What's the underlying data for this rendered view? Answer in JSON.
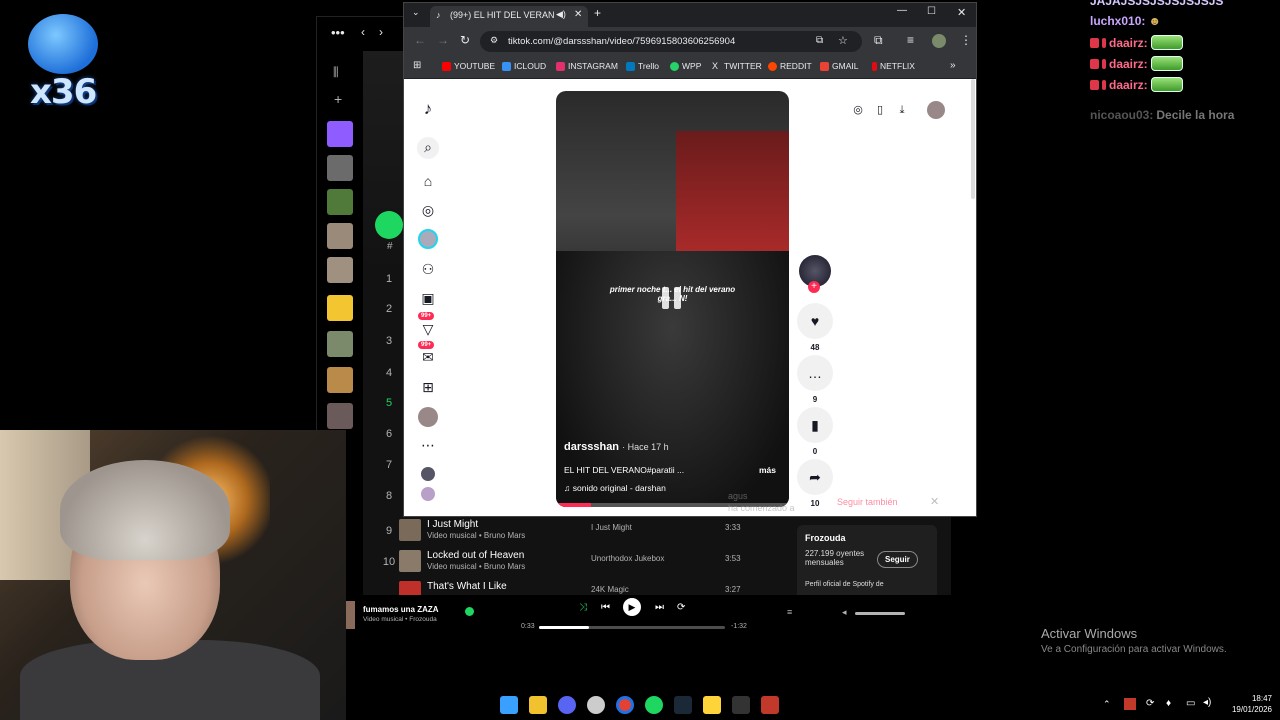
{
  "overlay": {
    "counter_text": "x36"
  },
  "chat": {
    "lines": [
      {
        "user": "JAJAJSJSJSJSJSJSJS",
        "msg": ""
      },
      {
        "user": "luchx010:",
        "msg": ""
      },
      {
        "user": "daairz:",
        "msg": ""
      },
      {
        "user": "daairz:",
        "msg": ""
      },
      {
        "user": "daairz:",
        "msg": ""
      },
      {
        "user": "nicoaou03:",
        "msg": "Decile la hora"
      }
    ]
  },
  "browser": {
    "tab_title": "(99+) EL HIT DEL VERANO",
    "new_tab_label": "+",
    "url": "tiktok.com/@darssshan/video/7596915803606256904",
    "bookmarks": [
      {
        "label": "YOUTUBE",
        "color": "#ff0000"
      },
      {
        "label": "ICLOUD",
        "color": "#3693f3"
      },
      {
        "label": "INSTAGRAM",
        "color": "#e1306c"
      },
      {
        "label": "Trello",
        "color": "#0079bf"
      },
      {
        "label": "WPP",
        "color": "#25d366"
      },
      {
        "label": "TWITTER",
        "color": "#e8eaed"
      },
      {
        "label": "REDDIT",
        "color": "#ff4500"
      },
      {
        "label": "GMAIL",
        "color": "#ea4335"
      },
      {
        "label": "NETFLIX",
        "color": "#e50914"
      }
    ],
    "more_bookmarks": "»"
  },
  "tiktok": {
    "nav_badges": [
      "99+",
      "99+"
    ],
    "video": {
      "overlay_line1": "primer noche t... el hit del verano",
      "overlay_line2": "gra... N!",
      "author": "darssshan",
      "time": "· Hace 17 h",
      "caption": "EL HIT DEL VERANO#paratii ...",
      "more": "más",
      "sound": "♫  sonido original - darshan",
      "progress": 0.15
    },
    "actions": {
      "likes": "48",
      "comments": "9",
      "saves": "0",
      "shares": "10"
    },
    "toast": {
      "user": "agus",
      "text": "ha comenzado a",
      "follow_back": "Seguir también"
    }
  },
  "spotify": {
    "track_numbers": [
      "1",
      "2",
      "3",
      "4",
      "5",
      "6",
      "7",
      "8"
    ],
    "hash_header": "#",
    "tracks": [
      {
        "num": "9",
        "title": "I Just Might",
        "sub": "Video musical • Bruno Mars",
        "album": "I Just Might",
        "dur": "3:33"
      },
      {
        "num": "10",
        "title": "Locked out of Heaven",
        "sub": "Video musical • Bruno Mars",
        "album": "Unorthodox Jukebox",
        "dur": "3:53"
      },
      {
        "num": "",
        "title": "That's What I Like",
        "sub": "",
        "album": "24K Magic",
        "dur": "3:27"
      }
    ],
    "artist_card": {
      "name": "Frozouda",
      "listeners": "227.199 oyentes mensuales",
      "follow": "Seguir",
      "desc": "Perfil oficial de Spotify de"
    },
    "player": {
      "title": "fumamos una ZAZA",
      "sub": "Video musical • Frozouda",
      "elapsed": "0:33",
      "remaining": "-1:32",
      "progress": 0.27
    }
  },
  "desktop": {
    "activate_title": "Activar Windows",
    "activate_sub": "Ve a Configuración para activar Windows.",
    "time": "18:47",
    "date": "19/01/2026"
  }
}
